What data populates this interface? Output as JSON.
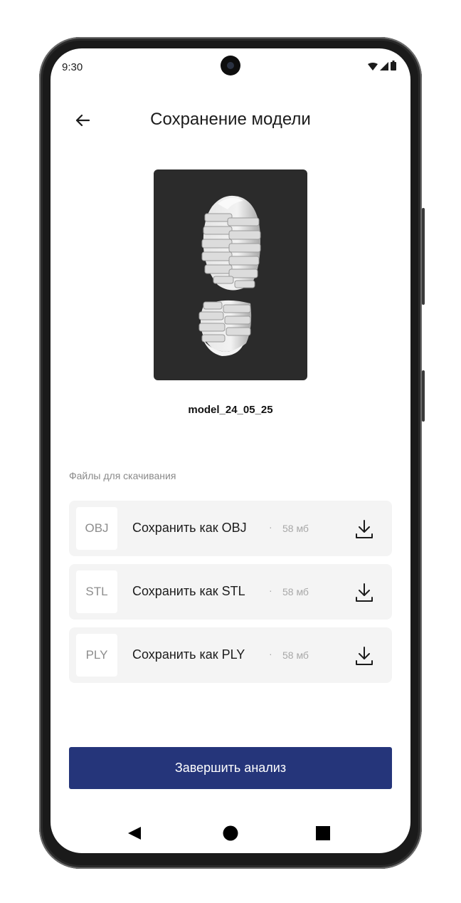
{
  "status_bar": {
    "time": "9:30",
    "icons": [
      "wifi-icon",
      "signal-icon",
      "battery-icon"
    ]
  },
  "app_bar": {
    "back_icon": "arrow-left-icon",
    "title": "Сохранение модели"
  },
  "preview": {
    "image_desc_icon": "shoe-sole-3d-model",
    "background_color": "#2b2b2b"
  },
  "model_name": "model_24_05_25",
  "files_section": {
    "label": "Файлы для скачивания",
    "items": [
      {
        "format": "OBJ",
        "label": "Сохранить как OBJ",
        "separator": "·",
        "size": "58 мб",
        "icon": "download-icon"
      },
      {
        "format": "STL",
        "label": "Сохранить как STL",
        "separator": "·",
        "size": "58 мб",
        "icon": "download-icon"
      },
      {
        "format": "PLY",
        "label": "Сохранить как PLY",
        "separator": "·",
        "size": "58 мб",
        "icon": "download-icon"
      }
    ]
  },
  "finish_button": {
    "label": "Завершить анализ",
    "color": "#25357a"
  },
  "nav_bar": {
    "icons": [
      "back-triangle-icon",
      "home-circle-icon",
      "recents-square-icon"
    ]
  }
}
